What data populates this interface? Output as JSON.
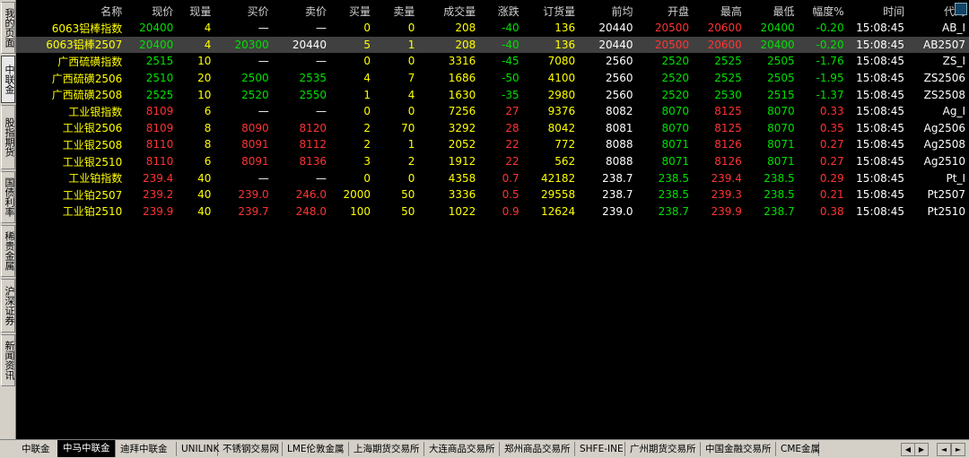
{
  "left_tabs": [
    {
      "label": "我的页面",
      "active": false
    },
    {
      "label": "中联金",
      "active": true
    },
    {
      "label": "股指期货",
      "active": false
    },
    {
      "label": "国债利率",
      "active": false
    },
    {
      "label": "稀贵金属",
      "active": false
    },
    {
      "label": "沪深证券",
      "active": false
    },
    {
      "label": "新闻资讯",
      "active": false
    }
  ],
  "headers": [
    "名称",
    "现价",
    "现量",
    "买价",
    "卖价",
    "买量",
    "卖量",
    "成交量",
    "涨跌",
    "订货量",
    "前均",
    "开盘",
    "最高",
    "最低",
    "幅度%",
    "时间",
    "代码"
  ],
  "rows": [
    {
      "cells": [
        "6063铝棒指数",
        "20400",
        "4",
        "—",
        "—",
        "0",
        "0",
        "208",
        "-40",
        "136",
        "20440",
        "20500",
        "20600",
        "20400",
        "-0.20",
        "15:08:45",
        "AB_I"
      ],
      "colors": [
        "name",
        "down",
        "vol",
        "flat",
        "flat",
        "vol",
        "vol",
        "vol",
        "down",
        "vol",
        "flat",
        "up",
        "up",
        "down",
        "down",
        "time",
        "code"
      ],
      "selected": false
    },
    {
      "cells": [
        "6063铝棒2507",
        "20400",
        "4",
        "20300",
        "20440",
        "5",
        "1",
        "208",
        "-40",
        "136",
        "20440",
        "20500",
        "20600",
        "20400",
        "-0.20",
        "15:08:45",
        "AB2507"
      ],
      "colors": [
        "name",
        "down",
        "vol",
        "down",
        "flat",
        "vol",
        "vol",
        "vol",
        "down",
        "vol",
        "flat",
        "up",
        "up",
        "down",
        "down",
        "time",
        "code"
      ],
      "selected": true
    },
    {
      "cells": [
        "广西硫磺指数",
        "2515",
        "10",
        "—",
        "—",
        "0",
        "0",
        "3316",
        "-45",
        "7080",
        "2560",
        "2520",
        "2525",
        "2505",
        "-1.76",
        "15:08:45",
        "ZS_I"
      ],
      "colors": [
        "name",
        "down",
        "vol",
        "flat",
        "flat",
        "vol",
        "vol",
        "vol",
        "down",
        "vol",
        "flat",
        "down",
        "down",
        "down",
        "down",
        "time",
        "code"
      ],
      "selected": false
    },
    {
      "cells": [
        "广西硫磺2506",
        "2510",
        "20",
        "2500",
        "2535",
        "4",
        "7",
        "1686",
        "-50",
        "4100",
        "2560",
        "2520",
        "2525",
        "2505",
        "-1.95",
        "15:08:45",
        "ZS2506"
      ],
      "colors": [
        "name",
        "down",
        "vol",
        "down",
        "down",
        "vol",
        "vol",
        "vol",
        "down",
        "vol",
        "flat",
        "down",
        "down",
        "down",
        "down",
        "time",
        "code"
      ],
      "selected": false
    },
    {
      "cells": [
        "广西硫磺2508",
        "2525",
        "10",
        "2520",
        "2550",
        "1",
        "4",
        "1630",
        "-35",
        "2980",
        "2560",
        "2520",
        "2530",
        "2515",
        "-1.37",
        "15:08:45",
        "ZS2508"
      ],
      "colors": [
        "name",
        "down",
        "vol",
        "down",
        "down",
        "vol",
        "vol",
        "vol",
        "down",
        "vol",
        "flat",
        "down",
        "down",
        "down",
        "down",
        "time",
        "code"
      ],
      "selected": false
    },
    {
      "cells": [
        "工业银指数",
        "8109",
        "6",
        "—",
        "—",
        "0",
        "0",
        "7256",
        "27",
        "9376",
        "8082",
        "8070",
        "8125",
        "8070",
        "0.33",
        "15:08:45",
        "Ag_I"
      ],
      "colors": [
        "name",
        "up",
        "vol",
        "flat",
        "flat",
        "vol",
        "vol",
        "vol",
        "up",
        "vol",
        "flat",
        "down",
        "up",
        "down",
        "up",
        "time",
        "code"
      ],
      "selected": false
    },
    {
      "cells": [
        "工业银2506",
        "8109",
        "8",
        "8090",
        "8120",
        "2",
        "70",
        "3292",
        "28",
        "8042",
        "8081",
        "8070",
        "8125",
        "8070",
        "0.35",
        "15:08:45",
        "Ag2506"
      ],
      "colors": [
        "name",
        "up",
        "vol",
        "up",
        "up",
        "vol",
        "vol",
        "vol",
        "up",
        "vol",
        "flat",
        "down",
        "up",
        "down",
        "up",
        "time",
        "code"
      ],
      "selected": false
    },
    {
      "cells": [
        "工业银2508",
        "8110",
        "8",
        "8091",
        "8112",
        "2",
        "1",
        "2052",
        "22",
        "772",
        "8088",
        "8071",
        "8126",
        "8071",
        "0.27",
        "15:08:45",
        "Ag2508"
      ],
      "colors": [
        "name",
        "up",
        "vol",
        "up",
        "up",
        "vol",
        "vol",
        "vol",
        "up",
        "vol",
        "flat",
        "down",
        "up",
        "down",
        "up",
        "time",
        "code"
      ],
      "selected": false
    },
    {
      "cells": [
        "工业银2510",
        "8110",
        "6",
        "8091",
        "8136",
        "3",
        "2",
        "1912",
        "22",
        "562",
        "8088",
        "8071",
        "8126",
        "8071",
        "0.27",
        "15:08:45",
        "Ag2510"
      ],
      "colors": [
        "name",
        "up",
        "vol",
        "up",
        "up",
        "vol",
        "vol",
        "vol",
        "up",
        "vol",
        "flat",
        "down",
        "up",
        "down",
        "up",
        "time",
        "code"
      ],
      "selected": false
    },
    {
      "cells": [
        "工业铂指数",
        "239.4",
        "40",
        "—",
        "—",
        "0",
        "0",
        "4358",
        "0.7",
        "42182",
        "238.7",
        "238.5",
        "239.4",
        "238.5",
        "0.29",
        "15:08:45",
        "Pt_I"
      ],
      "colors": [
        "name",
        "up",
        "vol",
        "flat",
        "flat",
        "vol",
        "vol",
        "vol",
        "up",
        "vol",
        "flat",
        "down",
        "up",
        "down",
        "up",
        "time",
        "code"
      ],
      "selected": false
    },
    {
      "cells": [
        "工业铂2507",
        "239.2",
        "40",
        "239.0",
        "246.0",
        "2000",
        "50",
        "3336",
        "0.5",
        "29558",
        "238.7",
        "238.5",
        "239.3",
        "238.5",
        "0.21",
        "15:08:45",
        "Pt2507"
      ],
      "colors": [
        "name",
        "up",
        "vol",
        "up",
        "up",
        "vol",
        "vol",
        "vol",
        "up",
        "vol",
        "flat",
        "down",
        "up",
        "down",
        "up",
        "time",
        "code"
      ],
      "selected": false
    },
    {
      "cells": [
        "工业铂2510",
        "239.9",
        "40",
        "239.7",
        "248.0",
        "100",
        "50",
        "1022",
        "0.9",
        "12624",
        "239.0",
        "238.7",
        "239.9",
        "238.7",
        "0.38",
        "15:08:45",
        "Pt2510"
      ],
      "colors": [
        "name",
        "up",
        "vol",
        "up",
        "up",
        "vol",
        "vol",
        "vol",
        "up",
        "vol",
        "flat",
        "down",
        "up",
        "down",
        "up",
        "time",
        "code"
      ],
      "selected": false
    }
  ],
  "bottom_tabs": [
    {
      "label": "中联金",
      "active": false
    },
    {
      "label": "中马中联金",
      "active": true
    },
    {
      "label": "迪拜中联金",
      "active": false
    },
    {
      "label": "UNILINK",
      "active": false
    },
    {
      "label": "不锈钢交易网",
      "active": false
    },
    {
      "label": "LME伦敦金属",
      "active": false
    },
    {
      "label": "上海期货交易所",
      "active": false
    },
    {
      "label": "大连商品交易所",
      "active": false
    },
    {
      "label": "郑州商品交易所",
      "active": false
    },
    {
      "label": "SHFE-INE",
      "active": false
    },
    {
      "label": "广州期货交易所",
      "active": false
    },
    {
      "label": "中国金融交易所",
      "active": false
    },
    {
      "label": "CME金属",
      "active": false
    }
  ],
  "icons": {
    "corner": "settings-icon",
    "prev": "triangle-left-icon",
    "next": "triangle-right-icon",
    "scroll_left": "arrow-left-icon",
    "scroll_right": "arrow-right-icon"
  }
}
